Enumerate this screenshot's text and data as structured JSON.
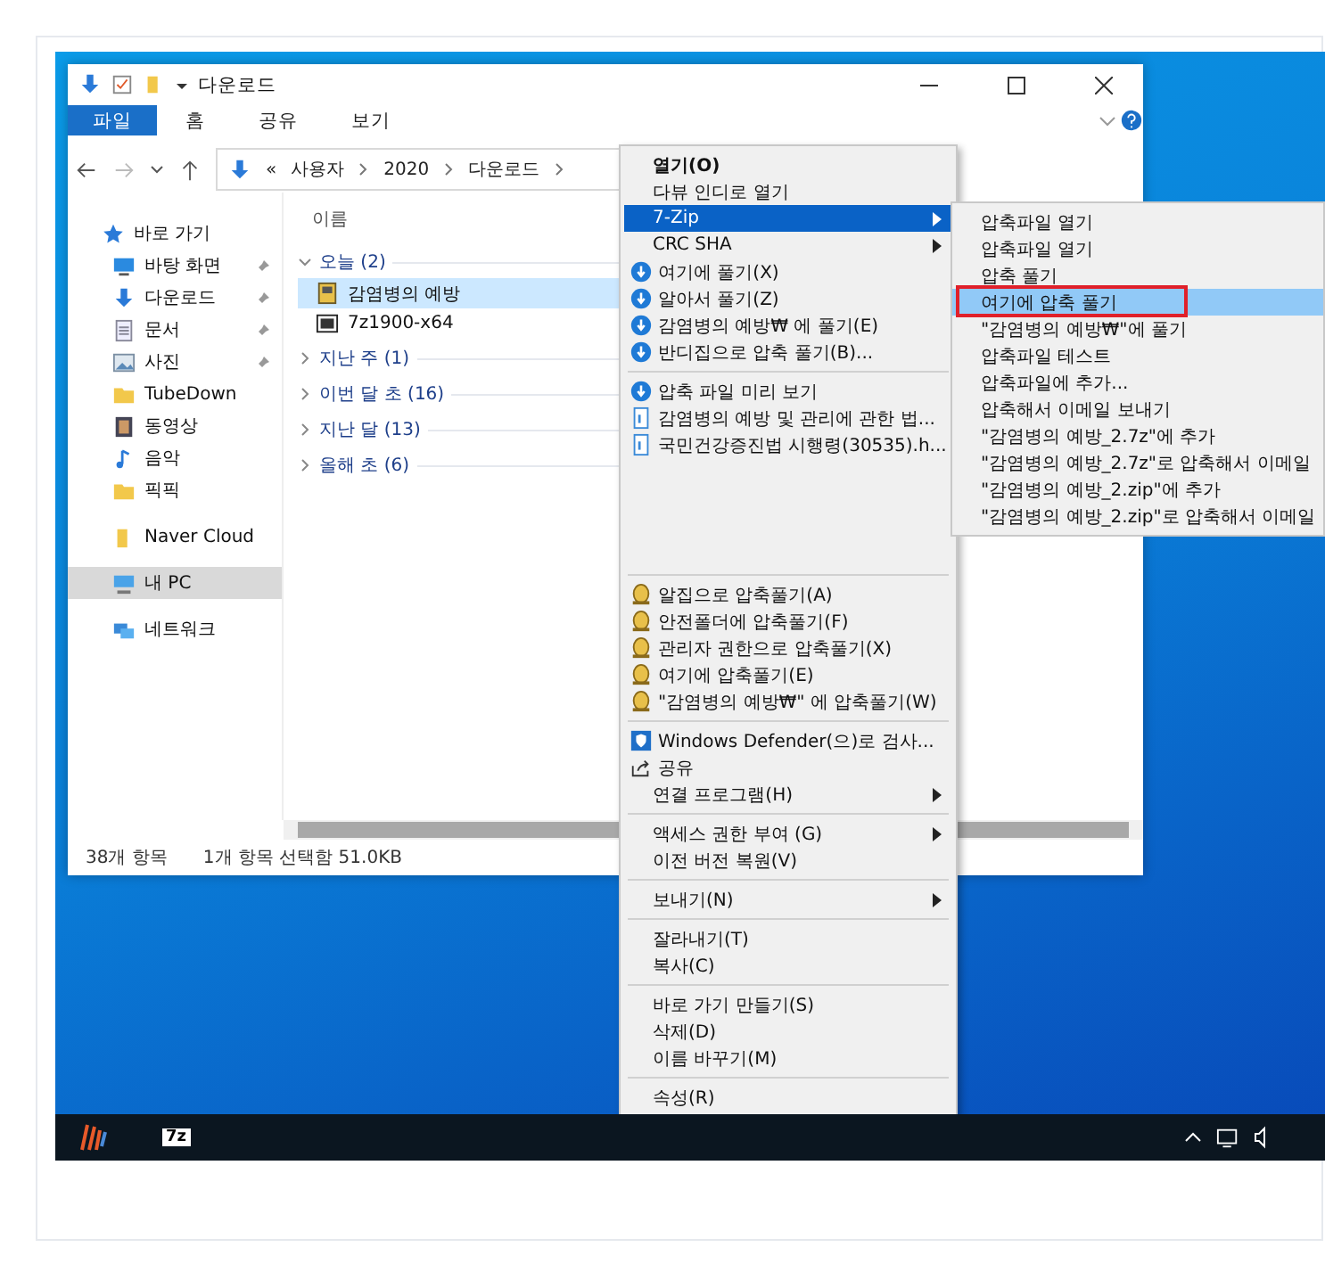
{
  "explorer": {
    "title": "다운로드",
    "ribbon_tabs": [
      {
        "label": "파일",
        "selected": true
      },
      {
        "label": "홈",
        "selected": false
      },
      {
        "label": "공유",
        "selected": false
      },
      {
        "label": "보기",
        "selected": false
      }
    ],
    "address": {
      "overflow": "«",
      "segments": [
        "사용자",
        "2020",
        "다운로드"
      ]
    },
    "nav_pane": [
      {
        "label": "바로 가기",
        "kind": "star",
        "pinned": false,
        "selected": false
      },
      {
        "label": "바탕 화면",
        "kind": "desktop",
        "pinned": true,
        "selected": false
      },
      {
        "label": "다운로드",
        "kind": "download",
        "pinned": true,
        "selected": false
      },
      {
        "label": "문서",
        "kind": "doc",
        "pinned": true,
        "selected": false
      },
      {
        "label": "사진",
        "kind": "picture",
        "pinned": true,
        "selected": false
      },
      {
        "label": "TubeDown",
        "kind": "folder",
        "pinned": false,
        "selected": false
      },
      {
        "label": "동영상",
        "kind": "video",
        "pinned": false,
        "selected": false
      },
      {
        "label": "음악",
        "kind": "music",
        "pinned": false,
        "selected": false
      },
      {
        "label": "픽픽",
        "kind": "folder",
        "pinned": false,
        "selected": false
      },
      {
        "label": "Naver Cloud",
        "kind": "cloud",
        "pinned": false,
        "selected": false
      },
      {
        "label": "내 PC",
        "kind": "pc",
        "pinned": false,
        "selected": true
      },
      {
        "label": "네트워크",
        "kind": "network",
        "pinned": false,
        "selected": false
      }
    ],
    "column": "이름",
    "groups": [
      {
        "label": "오늘 (2)",
        "expanded": true,
        "files": [
          {
            "name": "감염병의 예방",
            "kind": "archive",
            "selected": true
          },
          {
            "name": "7z1900-x64",
            "kind": "installer",
            "selected": false
          }
        ]
      },
      {
        "label": "지난 주 (1)",
        "expanded": false
      },
      {
        "label": "이번 달 초 (16)",
        "expanded": false
      },
      {
        "label": "지난 달 (13)",
        "expanded": false
      },
      {
        "label": "올해 초 (6)",
        "expanded": false
      }
    ],
    "status_bar": [
      "38개 항목",
      "1개 항목 선택함 51.0KB"
    ]
  },
  "context_menu": [
    [
      {
        "label": "열기(O)",
        "kind": "plain",
        "bold": true,
        "selected": false
      },
      {
        "label": "다뷰 인디로 열기",
        "kind": "plain",
        "selected": false
      },
      {
        "label": "7-Zip",
        "kind": "plain",
        "submenu": true,
        "selected": true
      },
      {
        "label": "CRC SHA",
        "kind": "plain",
        "submenu": true,
        "selected": false
      },
      {
        "label": "여기에 풀기(X)",
        "kind": "bandizip",
        "selected": false
      },
      {
        "label": "알아서 풀기(Z)",
        "kind": "bandizip",
        "selected": false
      },
      {
        "label": "감염병의 예방₩ 에 풀기(E)",
        "kind": "bandizip",
        "selected": false
      },
      {
        "label": "반디집으로 압축 풀기(B)...",
        "kind": "bandizip",
        "selected": false
      }
    ],
    [
      {
        "label": "압축 파일 미리 보기",
        "kind": "bandizip",
        "selected": false
      },
      {
        "label": "감염병의 예방 및 관리에 관한 법...",
        "kind": "document",
        "selected": false
      },
      {
        "label": "국민건강증진법 시행령(30535).h...",
        "kind": "document",
        "selected": false
      }
    ],
    [
      {
        "label": "알집으로 압축풀기(A)",
        "kind": "alzip",
        "selected": false
      },
      {
        "label": "안전폴더에 압축풀기(F)",
        "kind": "alzip",
        "selected": false
      },
      {
        "label": "관리자 권한으로 압축풀기(X)",
        "kind": "alzip",
        "selected": false
      },
      {
        "label": "여기에 압축풀기(E)",
        "kind": "alzip",
        "selected": false
      },
      {
        "label": "\"감염병의 예방₩\" 에 압축풀기(W)",
        "kind": "alzip",
        "selected": false
      }
    ],
    [
      {
        "label": "Windows Defender(으)로 검사...",
        "kind": "defender",
        "selected": false
      },
      {
        "label": "공유",
        "kind": "share",
        "selected": false
      },
      {
        "label": "연결 프로그램(H)",
        "kind": "plain",
        "submenu": true,
        "selected": false
      }
    ],
    [
      {
        "label": "액세스 권한 부여 (G)",
        "kind": "plain",
        "submenu": true,
        "selected": false
      },
      {
        "label": "이전 버전 복원(V)",
        "kind": "plain",
        "selected": false
      }
    ],
    [
      {
        "label": "보내기(N)",
        "kind": "plain",
        "submenu": true,
        "selected": false
      }
    ],
    [
      {
        "label": "잘라내기(T)",
        "kind": "plain",
        "selected": false
      },
      {
        "label": "복사(C)",
        "kind": "plain",
        "selected": false
      }
    ],
    [
      {
        "label": "바로 가기 만들기(S)",
        "kind": "plain",
        "selected": false
      },
      {
        "label": "삭제(D)",
        "kind": "plain",
        "selected": false
      },
      {
        "label": "이름 바꾸기(M)",
        "kind": "plain",
        "selected": false
      }
    ],
    [
      {
        "label": "속성(R)",
        "kind": "plain",
        "selected": false
      }
    ]
  ],
  "submenu": [
    {
      "label": "압축파일 열기",
      "selected": false
    },
    {
      "label": "압축파일 열기",
      "selected": false
    },
    {
      "label": "압축 풀기",
      "selected": false
    },
    {
      "label": "여기에 압축 풀기",
      "selected": true,
      "marked": true
    },
    {
      "label": "\"감염병의 예방₩\"에 풀기",
      "selected": false
    },
    {
      "label": "압축파일 테스트",
      "selected": false
    },
    {
      "label": "압축파일에 추가...",
      "selected": false
    },
    {
      "label": "압축해서 이메일 보내기",
      "selected": false
    },
    {
      "label": "\"감염병의 예방_2.7z\"에 추가",
      "selected": false
    },
    {
      "label": "\"감염병의 예방_2.7z\"로 압축해서 이메일",
      "selected": false
    },
    {
      "label": "\"감염병의 예방_2.zip\"에 추가",
      "selected": false
    },
    {
      "label": "\"감염병의 예방_2.zip\"로 압축해서 이메일",
      "selected": false
    }
  ],
  "taskbar": {
    "apps": [
      {
        "kind": "picpick"
      },
      {
        "kind": "sevenzip",
        "label": "7z"
      }
    ]
  }
}
